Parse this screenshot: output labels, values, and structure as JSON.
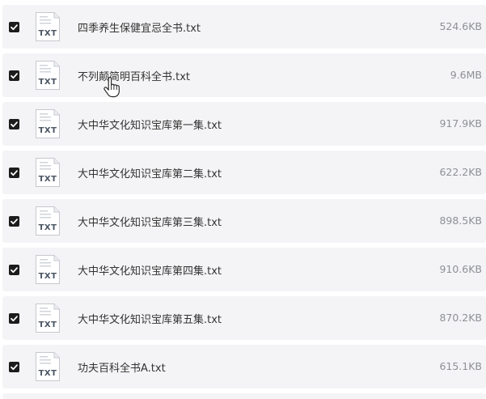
{
  "files": [
    {
      "name": "四季养生保健宜忌全书.txt",
      "size": "524.6KB",
      "type": "TXT",
      "checked": true
    },
    {
      "name": "不列颠简明百科全书.txt",
      "size": "9.6MB",
      "type": "TXT",
      "checked": true
    },
    {
      "name": "大中华文化知识宝库第一集.txt",
      "size": "917.9KB",
      "type": "TXT",
      "checked": true
    },
    {
      "name": "大中华文化知识宝库第二集.txt",
      "size": "622.2KB",
      "type": "TXT",
      "checked": true
    },
    {
      "name": "大中华文化知识宝库第三集.txt",
      "size": "898.5KB",
      "type": "TXT",
      "checked": true
    },
    {
      "name": "大中华文化知识宝库第四集.txt",
      "size": "910.6KB",
      "type": "TXT",
      "checked": true
    },
    {
      "name": "大中华文化知识宝库第五集.txt",
      "size": "870.2KB",
      "type": "TXT",
      "checked": true
    },
    {
      "name": "功夫百科全书A.txt",
      "size": "615.1KB",
      "type": "TXT",
      "checked": true
    }
  ],
  "colors": {
    "row_background": "#f4f4f6",
    "checkbox": "#1c1c1c",
    "name_text": "#333333",
    "size_text": "#8e9096"
  },
  "icons": {
    "checkbox": "checkmark-icon",
    "file": "txt-file-icon",
    "cursor": "hand-pointer-cursor"
  }
}
